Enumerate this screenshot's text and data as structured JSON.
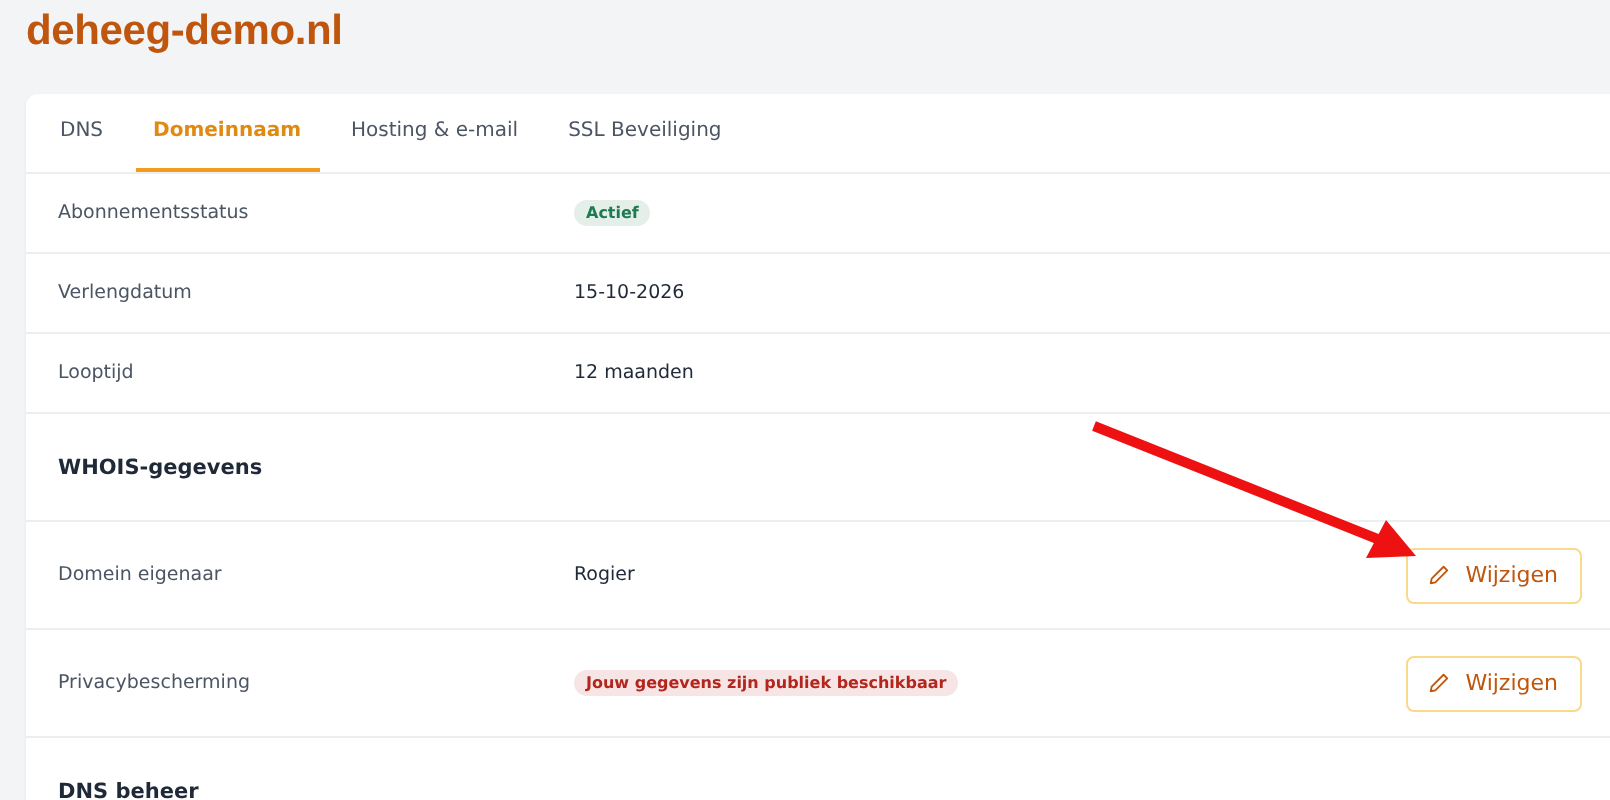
{
  "site_title": "deheeg-demo.nl",
  "tabs": [
    {
      "label": "DNS",
      "selected": false
    },
    {
      "label": "Domeinnaam",
      "selected": true
    },
    {
      "label": "Hosting & e-mail",
      "selected": false
    },
    {
      "label": "SSL Beveiliging",
      "selected": false
    }
  ],
  "rows": [
    {
      "kind": "field",
      "label": "Abonnementsstatus",
      "badge": {
        "text": "Actief",
        "color": "#1f7a52"
      }
    },
    {
      "kind": "field",
      "label": "Verlengdatum",
      "value": "15-10-2026"
    },
    {
      "kind": "field",
      "label": "Looptijd",
      "value": "12 maanden"
    },
    {
      "kind": "section",
      "title": "WHOIS-gegevens"
    },
    {
      "kind": "field",
      "label": "Domein eigenaar",
      "value": "Rogier",
      "action": "Wijzigen"
    },
    {
      "kind": "field",
      "label": "Privacybescherming",
      "badge": {
        "text": "Jouw gegevens zijn publiek beschikbaar",
        "color": "#b3261e"
      },
      "action": "Wijzigen"
    },
    {
      "kind": "section",
      "title": "DNS beheer"
    }
  ]
}
